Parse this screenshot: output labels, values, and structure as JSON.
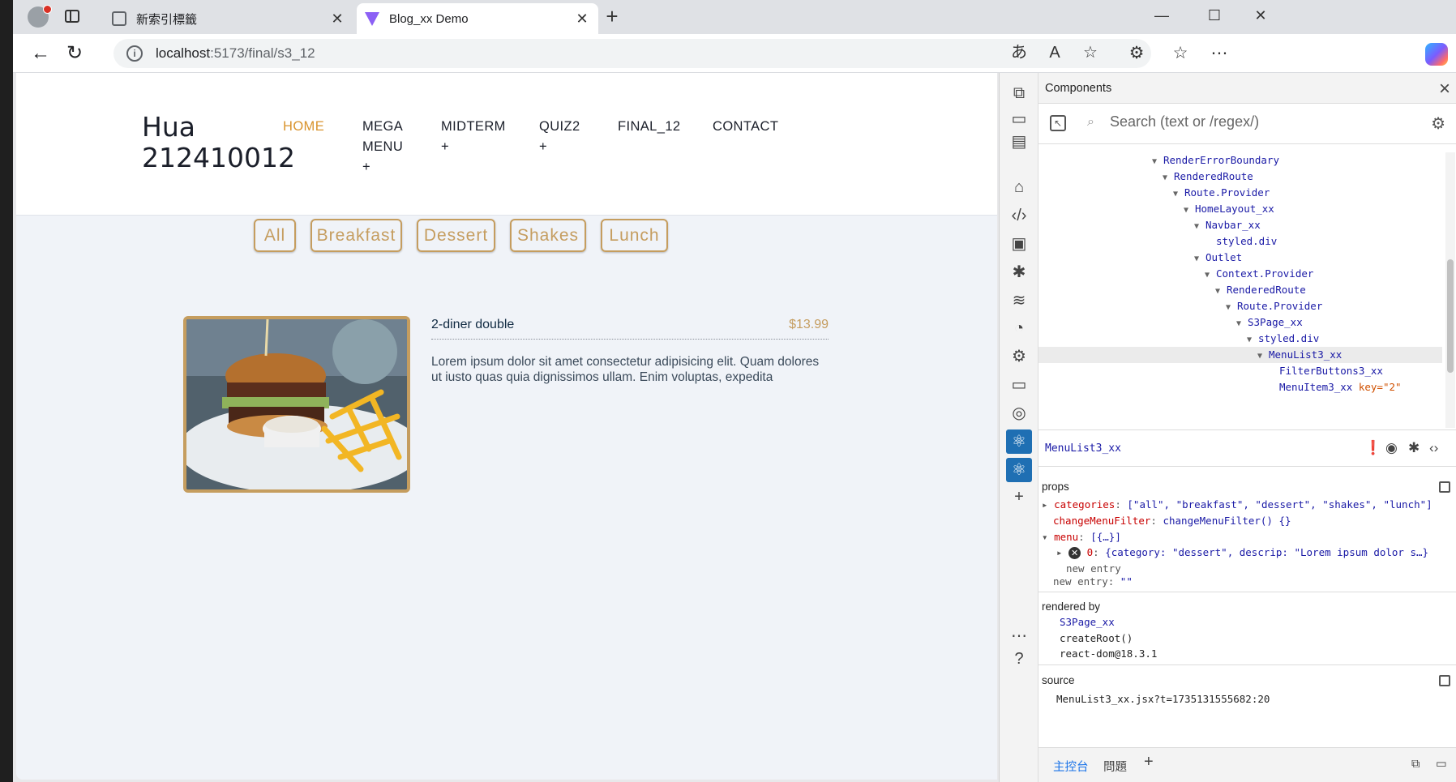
{
  "browser": {
    "tabs": [
      {
        "title": "新索引標籤",
        "active": false,
        "close": "✕"
      },
      {
        "title": "Blog_xx Demo",
        "active": true,
        "close": "✕"
      }
    ],
    "new_tab": "+",
    "window": {
      "minimize": "—",
      "maximize": "☐",
      "close": "✕"
    },
    "address": {
      "host": "localhost",
      "path": ":5173/final/s3_12"
    }
  },
  "site": {
    "brand_line1": "Hua",
    "brand_line2": "212410012",
    "nav": [
      {
        "label": "HOME",
        "active": true
      },
      {
        "label": "MEGA\nMENU\n+",
        "active": false
      },
      {
        "label": "MIDTERM\n+",
        "active": false
      },
      {
        "label": "QUIZ2\n+",
        "active": false
      },
      {
        "label": "FINAL_12",
        "active": false
      },
      {
        "label": "CONTACT",
        "active": false
      }
    ],
    "filters": [
      "All",
      "Breakfast",
      "Dessert",
      "Shakes",
      "Lunch"
    ],
    "menu_item": {
      "name": "2-diner double",
      "price": "$13.99",
      "description": "Lorem ipsum dolor sit amet consectetur adipisicing elit. Quam dolores ut iusto quas quia dignissimos ullam. Enim voluptas, expedita"
    }
  },
  "devtools": {
    "panel_title": "Components",
    "search_placeholder": "Search (text or /regex/)",
    "tree": [
      {
        "name": "RenderErrorBoundary",
        "expanded": true
      },
      {
        "name": "RenderedRoute",
        "expanded": true
      },
      {
        "name": "Route.Provider",
        "expanded": true
      },
      {
        "name": "HomeLayout_xx",
        "expanded": true
      },
      {
        "name": "Navbar_xx",
        "expanded": true
      },
      {
        "name": "styled.div",
        "expanded": false
      },
      {
        "name": "Outlet",
        "expanded": true
      },
      {
        "name": "Context.Provider",
        "expanded": true
      },
      {
        "name": "RenderedRoute",
        "expanded": true
      },
      {
        "name": "Route.Provider",
        "expanded": true
      },
      {
        "name": "S3Page_xx",
        "expanded": true
      },
      {
        "name": "styled.div",
        "expanded": true
      },
      {
        "name": "MenuList3_xx",
        "expanded": true,
        "selected": true
      },
      {
        "name": "FilterButtons3_xx",
        "expanded": false
      },
      {
        "name": "MenuItem3_xx",
        "expanded": false,
        "key": "key=\"2\""
      }
    ],
    "selected_component": "MenuList3_xx",
    "props_header": "props",
    "props": {
      "categories_key": "categories",
      "categories_val": "[\"all\", \"breakfast\", \"dessert\", \"shakes\", \"lunch\"]",
      "change_key": "changeMenuFilter",
      "change_val": "changeMenuFilter() {}",
      "menu_key": "menu",
      "menu_val": "[{…}]",
      "menu_item_key": "0",
      "menu_item_val": "{category: \"dessert\", descrip: \"Lorem ipsum dolor s…}",
      "new_entry_inner": "new entry",
      "new_entry_key": "new entry",
      "new_entry_val": "\"\""
    },
    "rendered_by_header": "rendered by",
    "rendered_by": [
      "S3Page_xx",
      "createRoot()",
      "react-dom@18.3.1"
    ],
    "source_header": "source",
    "source": "MenuList3_xx.jsx?t=1735131555682:20",
    "drawer_tabs": [
      "主控台",
      "問題"
    ]
  }
}
